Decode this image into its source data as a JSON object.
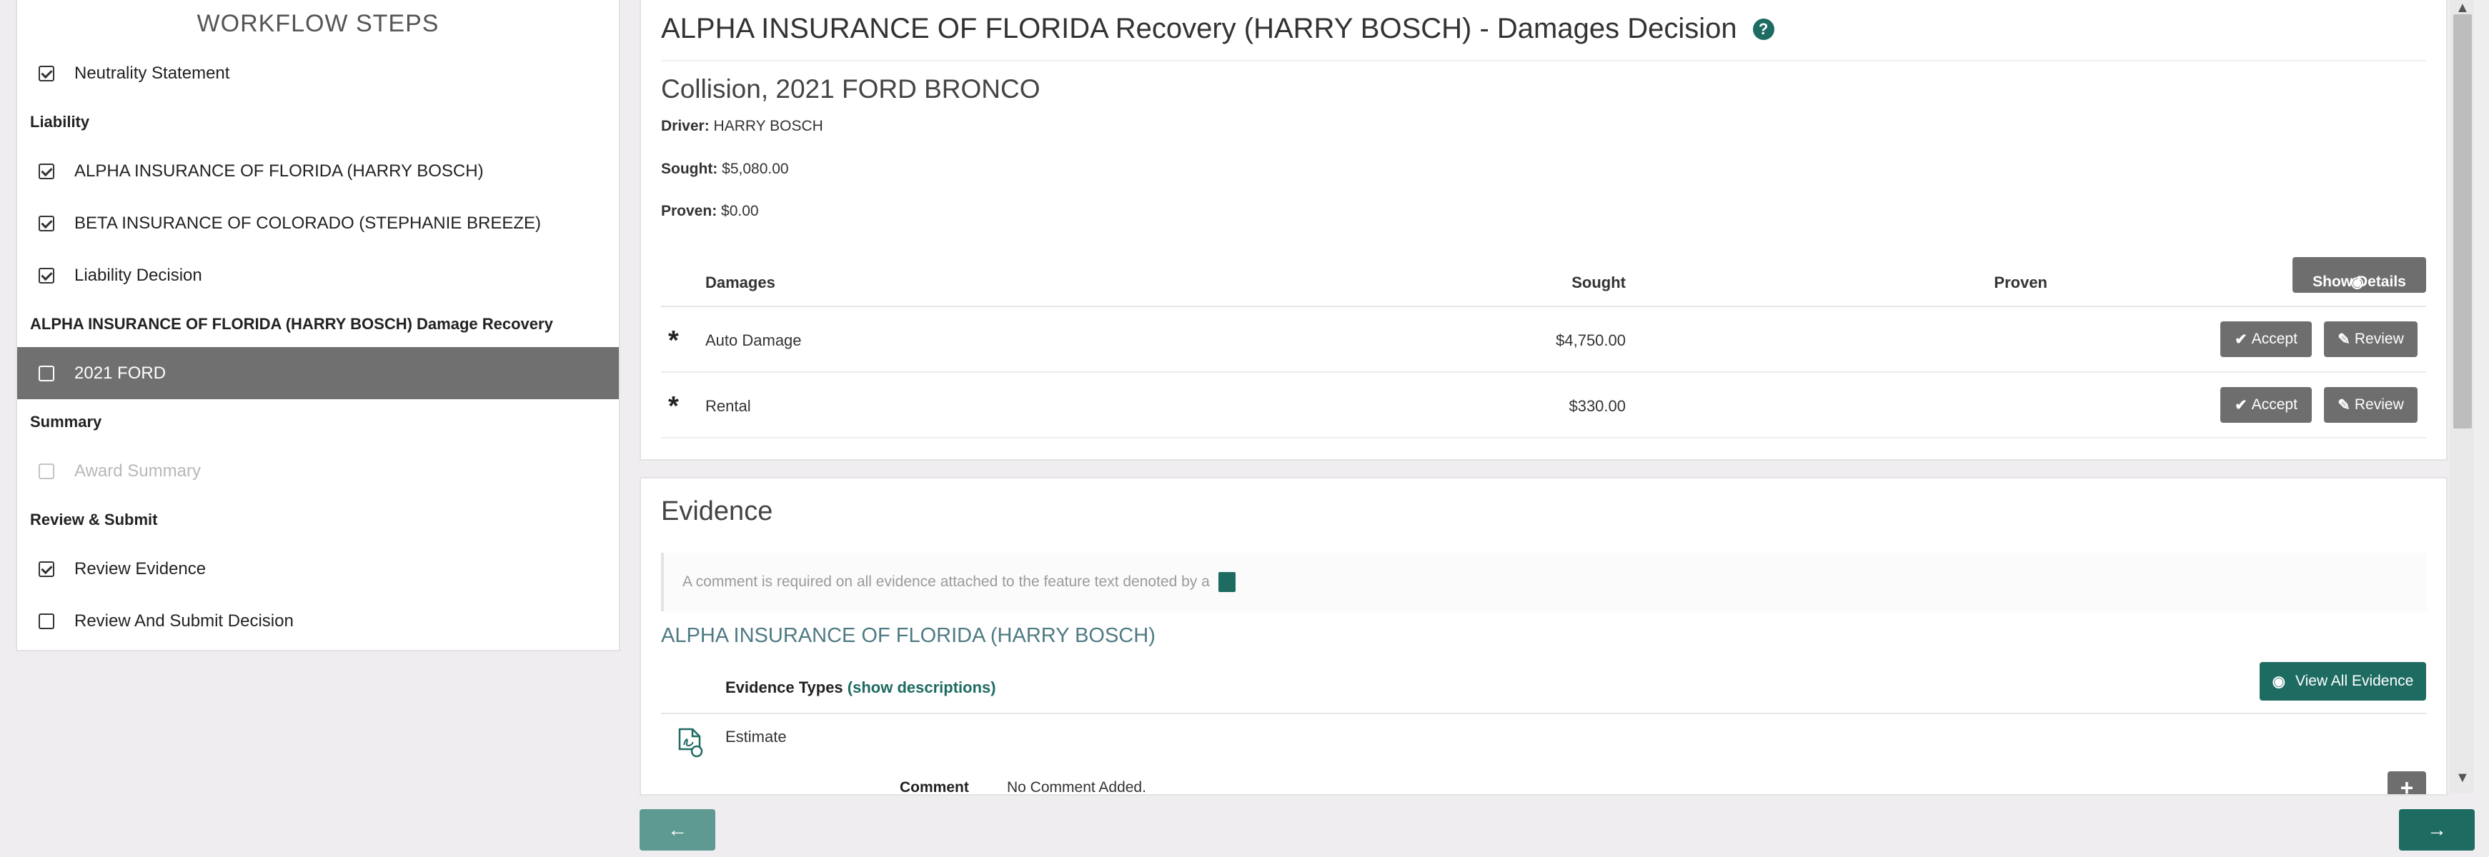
{
  "sidebar": {
    "title": "WORKFLOW STEPS",
    "neutrality": "Neutrality Statement",
    "section_liability": "Liability",
    "liability_items": [
      "ALPHA INSURANCE OF FLORIDA (HARRY BOSCH)",
      "BETA INSURANCE OF COLORADO (STEPHANIE BREEZE)",
      "Liability Decision"
    ],
    "section_recovery": "ALPHA INSURANCE OF FLORIDA (HARRY BOSCH) Damage Recovery",
    "recovery_item": "2021 FORD",
    "section_summary": "Summary",
    "summary_item": "Award Summary",
    "section_review": "Review & Submit",
    "review_items": [
      "Review Evidence",
      "Review And Submit Decision"
    ]
  },
  "header": {
    "title": "ALPHA INSURANCE OF FLORIDA Recovery (HARRY BOSCH) - Damages Decision",
    "help": "?"
  },
  "claim": {
    "subtitle": "Collision, 2021 FORD BRONCO",
    "driver_label": "Driver:",
    "driver": "HARRY BOSCH",
    "sought_label": "Sought:",
    "sought": "$5,080.00",
    "proven_label": "Proven:",
    "proven": "$0.00"
  },
  "damages_table": {
    "columns": [
      "Damages",
      "Sought",
      "Proven"
    ],
    "show_details": "Show Details",
    "rows": [
      {
        "name": "Auto Damage",
        "sought": "$4,750.00",
        "accept": "Accept",
        "review": "Review"
      },
      {
        "name": "Rental",
        "sought": "$330.00",
        "accept": "Accept",
        "review": "Review"
      }
    ]
  },
  "evidence": {
    "title": "Evidence",
    "note": "A comment is required on all evidence attached to the feature text denoted by a",
    "party": "ALPHA INSURANCE OF FLORIDA (HARRY BOSCH)",
    "types_label": "Evidence Types",
    "show_descriptions": "(show descriptions)",
    "view_all": "View All Evidence",
    "item_name": "Estimate",
    "comment_label": "Comment",
    "comment_value": "No Comment Added."
  },
  "nav": {
    "prev": "←",
    "next": "→"
  },
  "colors": {
    "accent": "#1e6b62",
    "button_grey": "#6e6e6e",
    "active_step": "#707070"
  }
}
